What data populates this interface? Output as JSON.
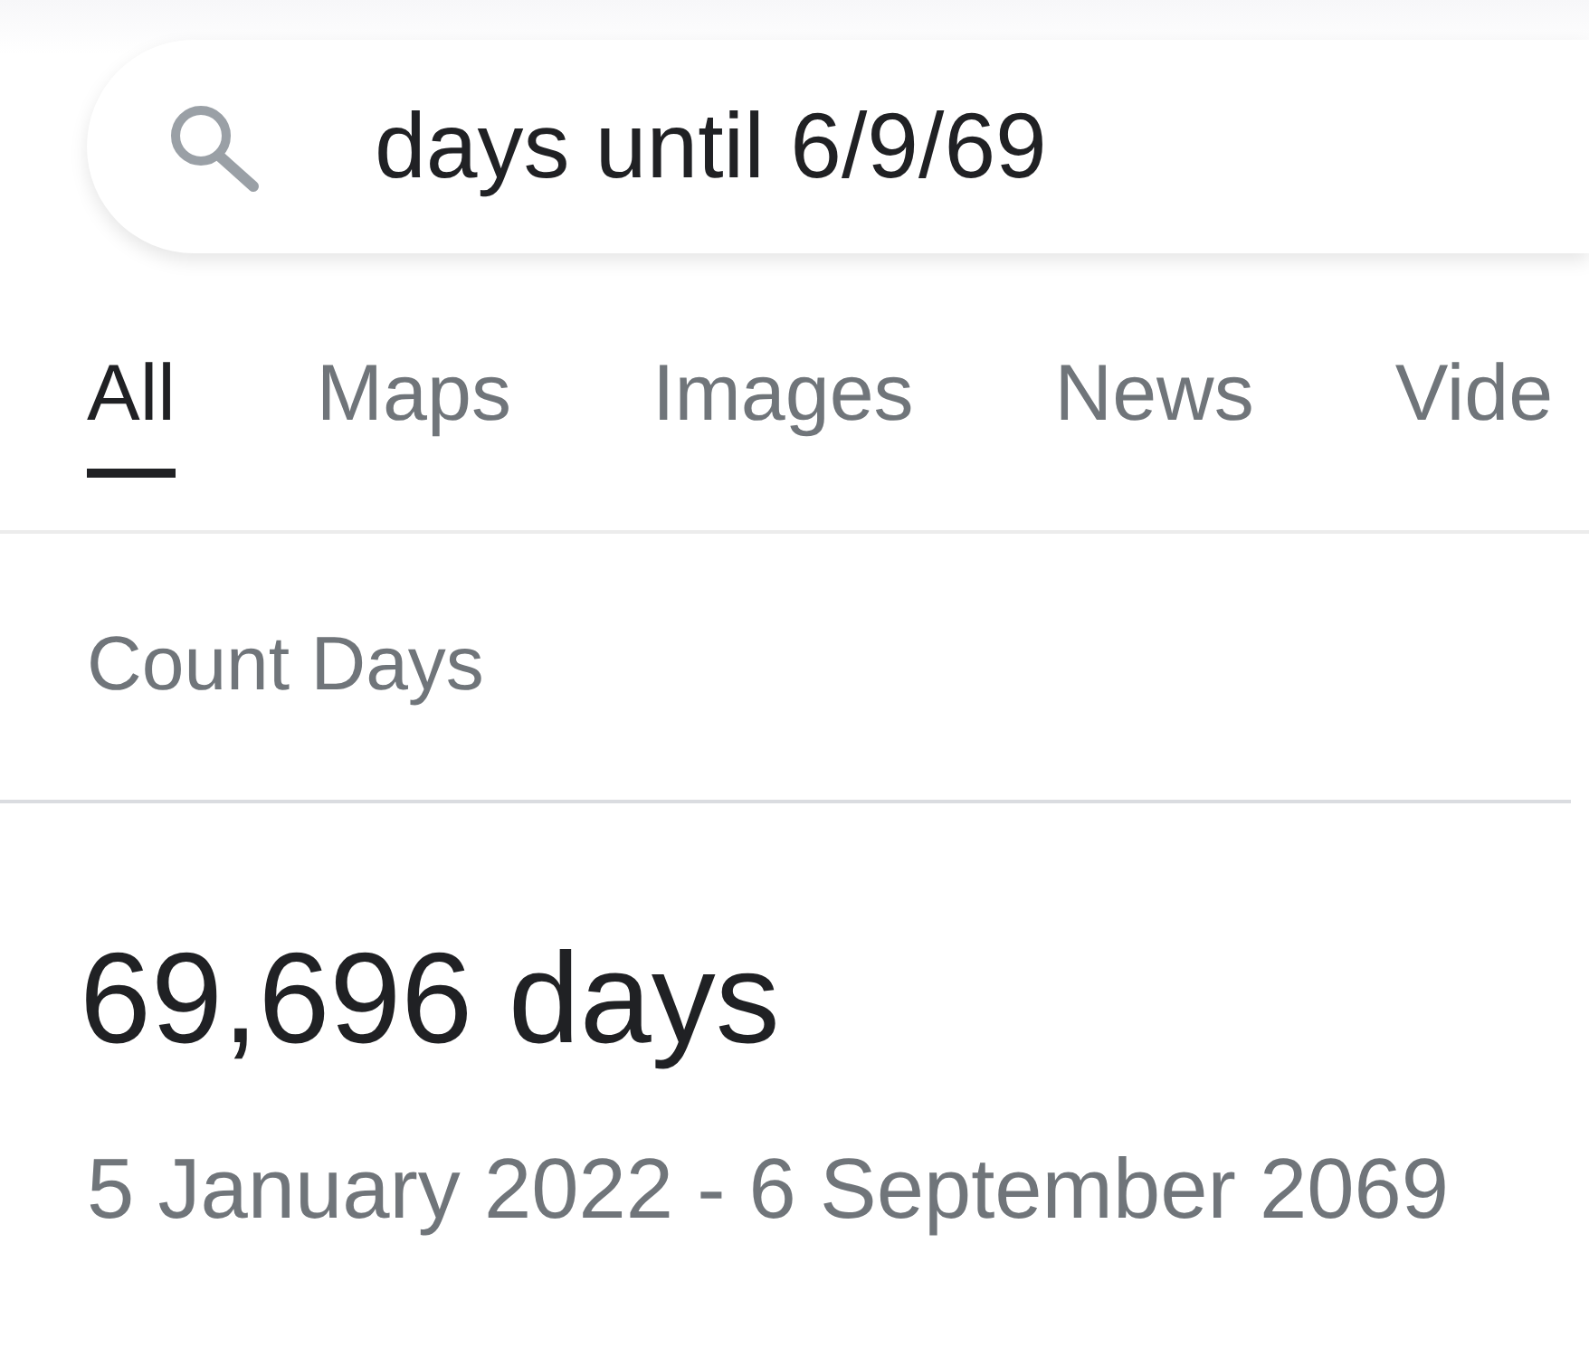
{
  "search": {
    "query": "days until 6/9/69"
  },
  "tabs": [
    {
      "label": "All",
      "selected": true
    },
    {
      "label": "Maps",
      "selected": false
    },
    {
      "label": "Images",
      "selected": false
    },
    {
      "label": "News",
      "selected": false
    },
    {
      "label": "Vide",
      "selected": false
    }
  ],
  "result": {
    "title": "Count Days",
    "value": "69,696 days",
    "range": "5 January 2022 - 6 September 2069"
  }
}
